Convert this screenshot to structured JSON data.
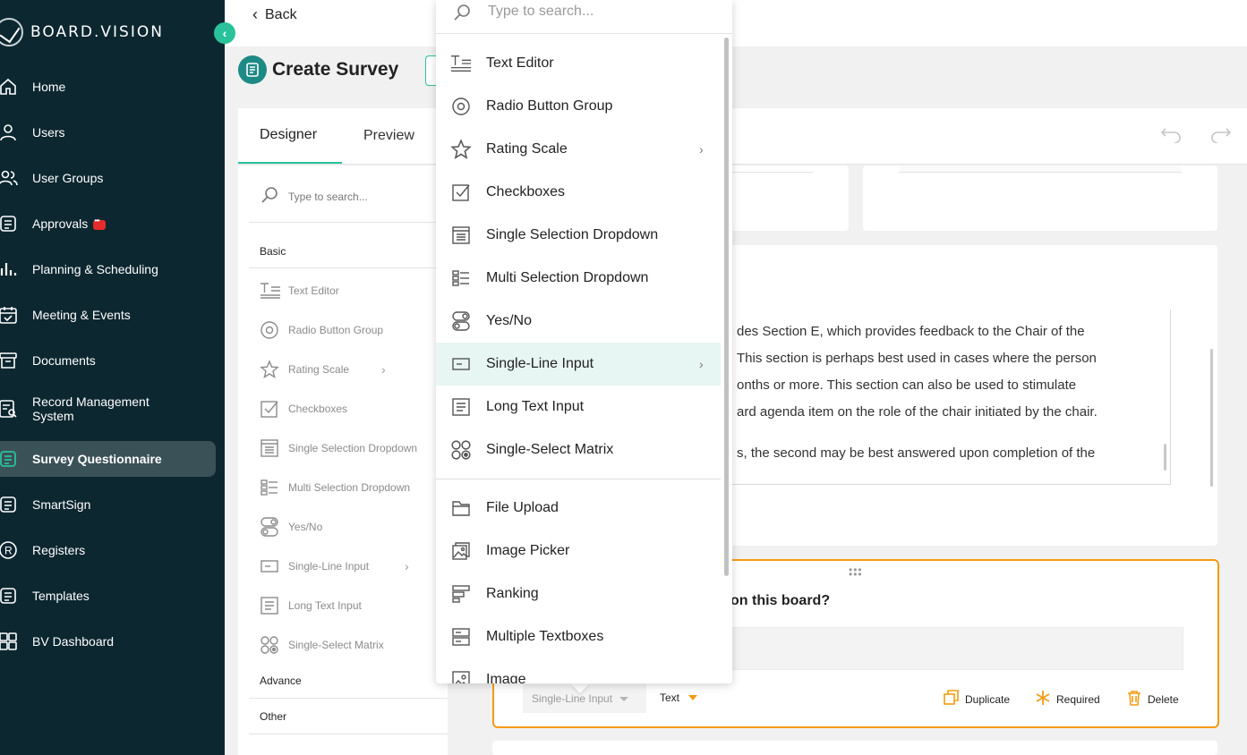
{
  "brand": {
    "name": "BOARD.VISION"
  },
  "sidebar": {
    "items": [
      {
        "label": "Home",
        "icon": "home-icon"
      },
      {
        "label": "Users",
        "icon": "user-icon"
      },
      {
        "label": "User Groups",
        "icon": "users-icon"
      },
      {
        "label": "Approvals",
        "icon": "approvals-icon"
      },
      {
        "label": "Planning & Scheduling",
        "icon": "bar-chart-icon"
      },
      {
        "label": "Meeting & Events",
        "icon": "calendar-icon"
      },
      {
        "label": "Documents",
        "icon": "archive-icon"
      },
      {
        "label": "Record Management System",
        "icon": "record-search-icon"
      },
      {
        "label": "Survey Questionnaire",
        "icon": "survey-icon",
        "active": true
      },
      {
        "label": "SmartSign",
        "icon": "sign-icon"
      },
      {
        "label": "Registers",
        "icon": "registered-icon"
      },
      {
        "label": "Templates",
        "icon": "template-icon"
      },
      {
        "label": "BV Dashboard",
        "icon": "dashboard-grid-icon"
      }
    ]
  },
  "header": {
    "back_label": "Back",
    "title": "Create Survey"
  },
  "tabs": [
    {
      "label": "Designer",
      "active": true
    },
    {
      "label": "Preview"
    }
  ],
  "toolbox": {
    "search_placeholder": "Type to search...",
    "categories": {
      "basic": "Basic",
      "advance": "Advance",
      "other": "Other"
    },
    "items": [
      {
        "label": "Text Editor"
      },
      {
        "label": "Radio Button Group"
      },
      {
        "label": "Rating Scale",
        "submenu": true
      },
      {
        "label": "Checkboxes"
      },
      {
        "label": "Single Selection Dropdown"
      },
      {
        "label": "Multi Selection Dropdown"
      },
      {
        "label": "Yes/No"
      },
      {
        "label": "Single-Line Input",
        "submenu": true
      },
      {
        "label": "Long Text Input"
      },
      {
        "label": "Single-Select Matrix"
      }
    ]
  },
  "popup": {
    "search_placeholder": "Type to search...",
    "items": [
      {
        "label": "Text Editor"
      },
      {
        "label": "Radio Button Group"
      },
      {
        "label": "Rating Scale",
        "submenu": true
      },
      {
        "label": "Checkboxes"
      },
      {
        "label": "Single Selection Dropdown"
      },
      {
        "label": "Multi Selection Dropdown"
      },
      {
        "label": "Yes/No"
      },
      {
        "label": "Single-Line Input",
        "submenu": true,
        "highlighted": true
      },
      {
        "label": "Long Text Input"
      },
      {
        "label": "Single-Select Matrix"
      }
    ],
    "items2": [
      {
        "label": "File Upload"
      },
      {
        "label": "Image Picker"
      },
      {
        "label": "Ranking"
      },
      {
        "label": "Multiple Textboxes"
      },
      {
        "label": "Image"
      }
    ]
  },
  "content": {
    "text_lines": [
      "des Section E, which provides feedback to the Chair of the",
      " This section is perhaps best used in cases where the person",
      "onths or more. This section can also be used to stimulate",
      "ard agenda item on the role of the chair initiated by the chair.",
      "s, the second may be best answered upon completion of the"
    ]
  },
  "question": {
    "title": "on this board?",
    "type_label": "Single-Line Input",
    "input_type": "Text",
    "actions": {
      "duplicate": "Duplicate",
      "required": "Required",
      "delete": "Delete"
    }
  },
  "colors": {
    "sidebar_bg": "#0c2730",
    "accent": "#29c29a",
    "highlight": "#f39c12",
    "title_icon": "#1e8a86"
  }
}
